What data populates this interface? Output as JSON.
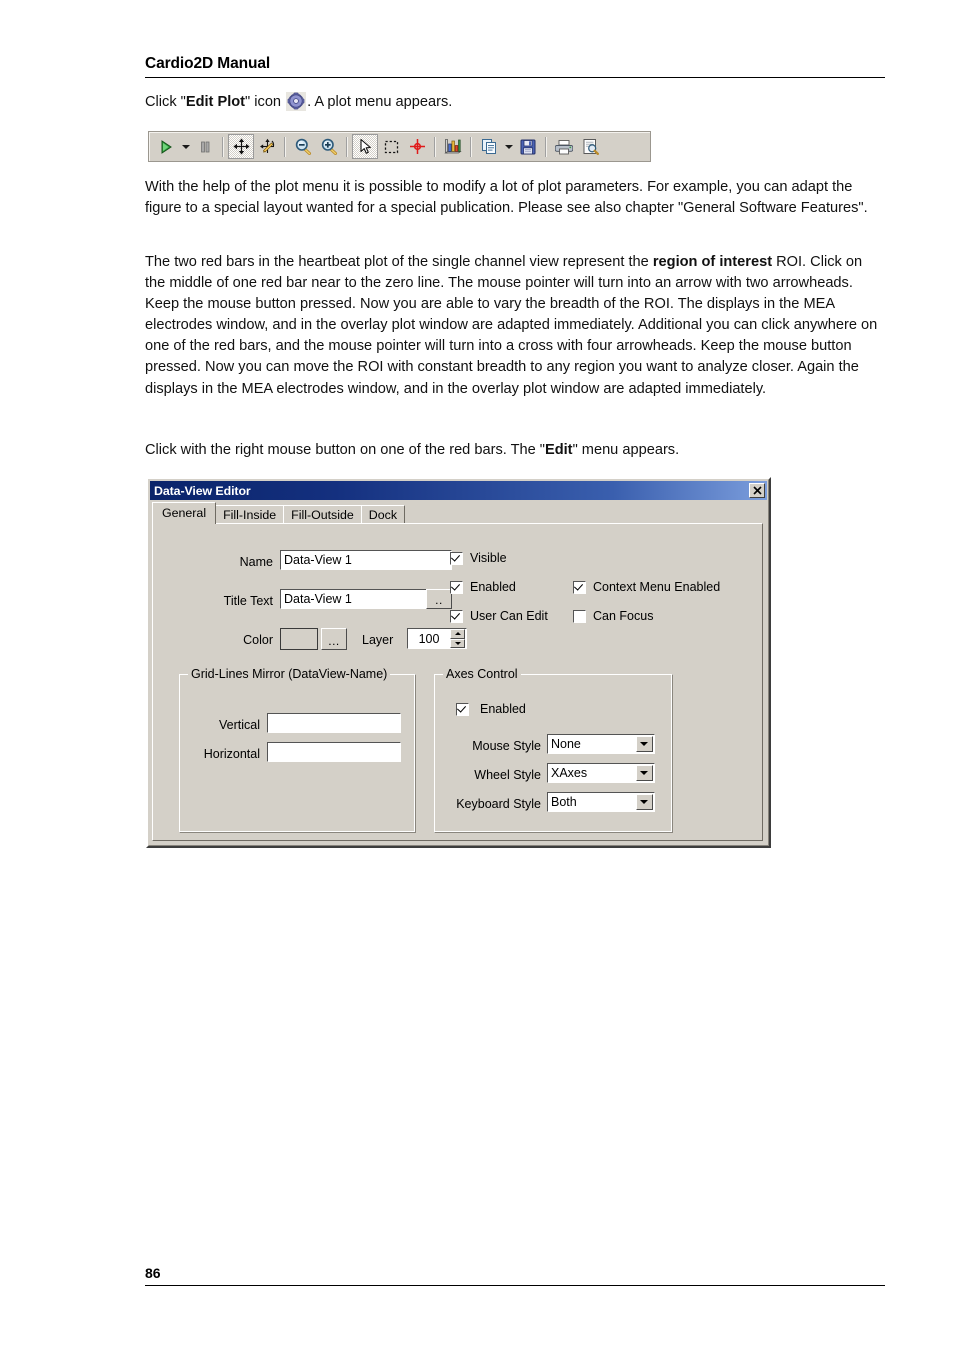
{
  "document": {
    "header_title": "Cardio2D Manual",
    "page_number": "86"
  },
  "intro": {
    "prefix": "Click \"",
    "bold1": "Edit Plot",
    "middle": "\" icon ",
    "icon_name": "gear-icon",
    "suffix": ". A plot menu appears."
  },
  "paragraphs": {
    "p1": "With the help of the plot menu it is possible to modify a lot of plot parameters. For example, you can adapt the figure to a special layout wanted for a special publication. Please see also chapter \"General Software Features\".",
    "p2_part1": "The two red bars in the heartbeat plot of the single channel view represent the ",
    "p2_bold": "region of interest",
    "p2_part2": " ROI. Click on the middle of one red bar near to the zero line. The mouse pointer will turn into an arrow with two arrowheads. Keep the mouse button pressed. Now you are able to vary the breadth of the ROI. The displays in the MEA electrodes window, and in the overlay plot window are adapted immediately. Additional you can click anywhere on one of the red bars, and the mouse pointer will turn into a cross with four arrowheads. Keep the mouse button pressed. Now you can move the ROI with constant breadth to any region you want to analyze closer. Again the displays in the MEA electrodes window, and in the overlay plot window are adapted immediately.",
    "p3_part1": "Click with the right mouse button on one of the red bars. The \"",
    "p3_bold": "Edit",
    "p3_part2": "\" menu appears."
  },
  "toolbar": {
    "buttons": [
      {
        "name": "run-button",
        "icon": "play-triangle-icon",
        "pressed": false
      },
      {
        "name": "run-dropdown",
        "icon": "chevron-down-icon",
        "pressed": false
      },
      {
        "name": "pause-button",
        "icon": "pause-icon",
        "pressed": false
      },
      {
        "name": "pan-button",
        "icon": "move-cross-icon",
        "pressed": true
      },
      {
        "name": "rotate-button",
        "icon": "rotate-axes-icon",
        "pressed": false
      },
      {
        "name": "zoom-out-button",
        "icon": "magnifier-minus-icon",
        "pressed": false
      },
      {
        "name": "zoom-in-button",
        "icon": "magnifier-plus-icon",
        "pressed": false
      },
      {
        "name": "select-button",
        "icon": "arrow-cursor-icon",
        "pressed": true
      },
      {
        "name": "rubber-band-button",
        "icon": "dashed-rectangle-icon",
        "pressed": false
      },
      {
        "name": "crosshair-button",
        "icon": "red-crosshair-icon",
        "pressed": false
      },
      {
        "name": "chart-properties-button",
        "icon": "bar-chart-icon",
        "pressed": false
      },
      {
        "name": "copy-button",
        "icon": "copy-pages-icon",
        "pressed": false
      },
      {
        "name": "copy-dropdown",
        "icon": "chevron-down-icon",
        "pressed": false
      },
      {
        "name": "save-button",
        "icon": "floppy-disk-icon",
        "pressed": false
      },
      {
        "name": "print-button",
        "icon": "printer-icon",
        "pressed": false
      },
      {
        "name": "print-preview-button",
        "icon": "print-preview-icon",
        "pressed": false
      }
    ]
  },
  "dialog": {
    "title": "Data-View Editor",
    "close_label": "✕",
    "tabs": [
      {
        "label": "General",
        "active": true
      },
      {
        "label": "Fill-Inside",
        "active": false
      },
      {
        "label": "Fill-Outside",
        "active": false
      },
      {
        "label": "Dock",
        "active": false
      }
    ],
    "fields": {
      "name_label": "Name",
      "name_value": "Data-View 1",
      "title_text_label": "Title Text",
      "title_text_value": "Data-View 1",
      "title_text_button": "..",
      "color_label": "Color",
      "color_value": "#d4d0c8",
      "color_button": "...",
      "layer_label": "Layer",
      "layer_value": "100"
    },
    "checkboxes": [
      {
        "label": "Visible",
        "checked": true
      },
      {
        "label": "Enabled",
        "checked": true
      },
      {
        "label": "Context Menu Enabled",
        "checked": true
      },
      {
        "label": "User Can Edit",
        "checked": true
      },
      {
        "label": "Can Focus",
        "checked": false
      }
    ],
    "grid_lines_mirror": {
      "title": "Grid-Lines Mirror (DataView-Name)",
      "vertical_label": "Vertical",
      "vertical_value": "",
      "horizontal_label": "Horizontal",
      "horizontal_value": ""
    },
    "axes_control": {
      "title": "Axes Control",
      "enabled_label": "Enabled",
      "enabled_checked": true,
      "mouse_style_label": "Mouse Style",
      "mouse_style_value": "None",
      "wheel_style_label": "Wheel Style",
      "wheel_style_value": "XAxes",
      "keyboard_style_label": "Keyboard Style",
      "keyboard_style_value": "Both"
    }
  }
}
